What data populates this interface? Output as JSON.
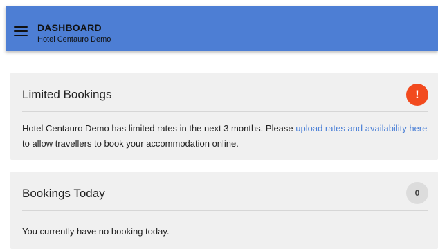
{
  "header": {
    "title": "DASHBOARD",
    "subtitle": "Hotel Centauro Demo",
    "menu_icon": "hamburger-menu-icon",
    "background_color": "#4d7ed4"
  },
  "cards": [
    {
      "title": "Limited Bookings",
      "badge": "!",
      "badge_color": "#f24a1e",
      "body_prefix": "Hotel Centauro Demo has limited rates in the next 3 months. Please ",
      "link_text": "upload rates and availability here",
      "body_suffix": " to allow travellers to book your accommodation online."
    },
    {
      "title": "Bookings Today",
      "badge": "0",
      "badge_color": "#dcdcdc",
      "body": "You currently have no booking today."
    }
  ],
  "colors": {
    "link": "#4a7fd6",
    "card_background": "#f0f0f0"
  }
}
